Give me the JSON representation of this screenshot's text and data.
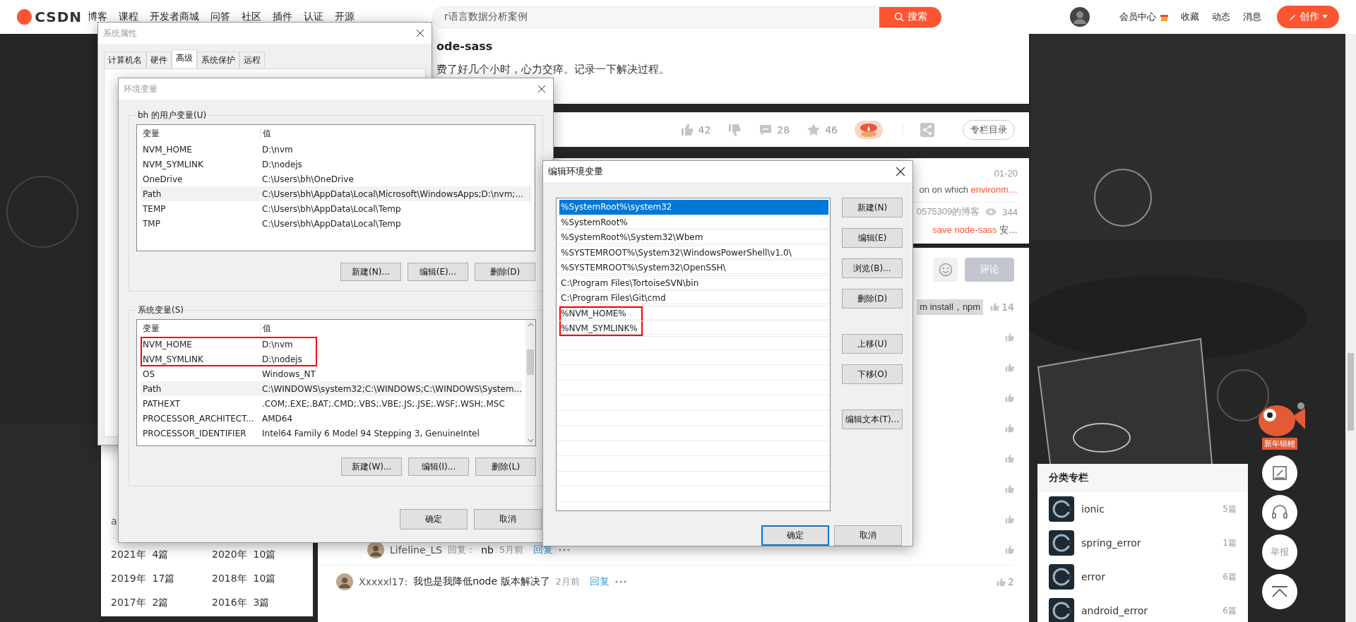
{
  "header": {
    "logo": "CSDN",
    "nav": [
      "博客",
      "课程",
      "开发者商城",
      "问答",
      "社区",
      "插件",
      "认证",
      "开源"
    ],
    "search": {
      "value": "r语言数据分析案例",
      "button": "搜索"
    },
    "user_links": [
      "会员中心",
      "收藏",
      "动态",
      "消息"
    ],
    "create_button": "创作"
  },
  "left_column": {
    "fragment": "a",
    "archive": [
      {
        "year": "2021年",
        "count": "4篇"
      },
      {
        "year": "2020年",
        "count": "10篇"
      },
      {
        "year": "2019年",
        "count": "17篇"
      },
      {
        "year": "2018年",
        "count": "10篇"
      },
      {
        "year": "2017年",
        "count": "2篇"
      },
      {
        "year": "2016年",
        "count": "3篇"
      }
    ]
  },
  "article": {
    "title_fragment": "ode-sass",
    "text_fragment": "费了好几个小时，心力交瘁。记录一下解决过程。",
    "actions": [
      {
        "kind": "like",
        "count": "42"
      },
      {
        "kind": "dislike"
      },
      {
        "kind": "comment",
        "count": "28"
      },
      {
        "kind": "favorite",
        "count": "46"
      },
      {
        "kind": "reward"
      },
      {
        "kind": "share"
      }
    ],
    "catalog_button": "专栏目录"
  },
  "recommendations": [
    {
      "date": "01-20",
      "text": "on on which",
      "highlight": "environm…"
    },
    {
      "source": "0575309的博客",
      "views": "344",
      "highlight": "save node-sass",
      "text": "安…"
    }
  ],
  "comment_box": {
    "submit": "评论",
    "disabled": true
  },
  "comments": [
    {
      "kind": "snippet",
      "text": "m install，npm",
      "likes": "14"
    },
    {
      "kind": "covered"
    },
    {
      "kind": "covered"
    },
    {
      "kind": "covered"
    },
    {
      "kind": "covered"
    },
    {
      "kind": "covered"
    },
    {
      "kind": "covered"
    },
    {
      "kind": "covered"
    },
    {
      "kind": "reply",
      "user": "Lifeline_LS",
      "reply_label": "回复：",
      "text": "nb",
      "time": "5月前",
      "reply": "回复"
    },
    {
      "kind": "comment",
      "user": "Xxxxxl17:",
      "text": "我也是我降低node 版本解决了",
      "time": "2月前",
      "reply": "回复",
      "likes": "2"
    }
  ],
  "categories": {
    "title": "分类专栏",
    "items": [
      {
        "name": "ionic",
        "count": "5篇"
      },
      {
        "name": "spring_error",
        "count": "1篇"
      },
      {
        "name": "error",
        "count": "6篇"
      },
      {
        "name": "android_error",
        "count": "6篇"
      }
    ]
  },
  "float_tools": {
    "mascot_label": "新年锦鲤",
    "report": "举报"
  },
  "system_properties": {
    "title": "系统属性",
    "tabs": [
      {
        "label": "计算机名",
        "selected": false
      },
      {
        "label": "硬件",
        "selected": false
      },
      {
        "label": "高级",
        "selected": true
      },
      {
        "label": "系统保护",
        "selected": false
      },
      {
        "label": "远程",
        "selected": false
      }
    ]
  },
  "env_vars": {
    "title": "环境变量",
    "groups": [
      {
        "label": "bh 的用户变量(U)",
        "columns": [
          "变量",
          "值"
        ],
        "scrollbar": false,
        "rows": [
          {
            "name": "NVM_HOME",
            "value": "D:\\nvm",
            "selected": false,
            "annotated": false
          },
          {
            "name": "NVM_SYMLINK",
            "value": "D:\\nodejs",
            "selected": false,
            "annotated": false
          },
          {
            "name": "OneDrive",
            "value": "C:\\Users\\bh\\OneDrive",
            "selected": false,
            "annotated": false
          },
          {
            "name": "Path",
            "value": "C:\\Users\\bh\\AppData\\Local\\Microsoft\\WindowsApps;D:\\nvm;...",
            "selected": true,
            "annotated": false
          },
          {
            "name": "TEMP",
            "value": "C:\\Users\\bh\\AppData\\Local\\Temp",
            "selected": false,
            "annotated": false
          },
          {
            "name": "TMP",
            "value": "C:\\Users\\bh\\AppData\\Local\\Temp",
            "selected": false,
            "annotated": false
          }
        ],
        "buttons": [
          "新建(N)...",
          "编辑(E)...",
          "删除(D)"
        ]
      },
      {
        "label": "系统变量(S)",
        "columns": [
          "变量",
          "值"
        ],
        "scrollbar": true,
        "rows": [
          {
            "name": "NVM_HOME",
            "value": "D:\\nvm",
            "selected": false,
            "annotated": true
          },
          {
            "name": "NVM_SYMLINK",
            "value": "D:\\nodejs",
            "selected": false,
            "annotated": true
          },
          {
            "name": "OS",
            "value": "Windows_NT",
            "selected": false,
            "annotated": false
          },
          {
            "name": "Path",
            "value": "C:\\WINDOWS\\system32;C:\\WINDOWS;C:\\WINDOWS\\System...",
            "selected": true,
            "annotated": false
          },
          {
            "name": "PATHEXT",
            "value": ".COM;.EXE;.BAT;.CMD;.VBS;.VBE;.JS;.JSE;.WSF;.WSH;.MSC",
            "selected": false,
            "annotated": false
          },
          {
            "name": "PROCESSOR_ARCHITECT...",
            "value": "AMD64",
            "selected": false,
            "annotated": false
          },
          {
            "name": "PROCESSOR_IDENTIFIER",
            "value": "Intel64 Family 6 Model 94 Stepping 3, GenuineIntel",
            "selected": false,
            "annotated": false
          }
        ],
        "buttons": [
          "新建(W)...",
          "编辑(I)...",
          "删除(L)"
        ]
      }
    ],
    "footer_buttons": [
      "确定",
      "取消"
    ]
  },
  "edit_env": {
    "title": "编辑环境变量",
    "entries": [
      {
        "value": "%SystemRoot%\\system32",
        "selected": true,
        "annotated": false
      },
      {
        "value": "%SystemRoot%",
        "selected": false,
        "annotated": false
      },
      {
        "value": "%SystemRoot%\\System32\\Wbem",
        "selected": false,
        "annotated": false
      },
      {
        "value": "%SYSTEMROOT%\\System32\\WindowsPowerShell\\v1.0\\",
        "selected": false,
        "annotated": false
      },
      {
        "value": "%SYSTEMROOT%\\System32\\OpenSSH\\",
        "selected": false,
        "annotated": false
      },
      {
        "value": "C:\\Program Files\\TortoiseSVN\\bin",
        "selected": false,
        "annotated": false
      },
      {
        "value": "C:\\Program Files\\Git\\cmd",
        "selected": false,
        "annotated": false
      },
      {
        "value": "%NVM_HOME%",
        "selected": false,
        "annotated": true
      },
      {
        "value": "%NVM_SYMLINK%",
        "selected": false,
        "annotated": true
      }
    ],
    "side_button_groups": [
      [
        "新建(N)",
        "编辑(E)",
        "浏览(B)...",
        "删除(D)"
      ],
      [
        "上移(U)",
        "下移(O)"
      ],
      [
        "编辑文本(T)..."
      ]
    ],
    "footer_buttons": [
      {
        "label": "确定",
        "default": true
      },
      {
        "label": "取消",
        "default": false
      }
    ]
  }
}
